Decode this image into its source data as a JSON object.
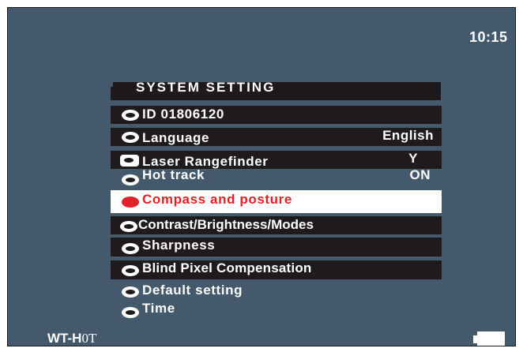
{
  "status": {
    "clock": "10:15",
    "model_prefix": "WT-H",
    "model_suffix": "0T"
  },
  "menu": {
    "title": "SYSTEM SETTING",
    "items": [
      {
        "label": "ID 01806120",
        "value": ""
      },
      {
        "label": "Language",
        "value": "English"
      },
      {
        "label": "Laser Rangefinder",
        "value": "Y"
      },
      {
        "label": "Hot track",
        "value": "ON"
      },
      {
        "label": "Compass and posture",
        "value": "",
        "selected": true
      },
      {
        "label": "Contrast/Brightness/Modes",
        "value": ""
      },
      {
        "label": "Sharpness",
        "value": ""
      },
      {
        "label": "Blind Pixel Compensation",
        "value": ""
      },
      {
        "label": "Default setting",
        "value": ""
      },
      {
        "label": "Time",
        "value": ""
      }
    ]
  },
  "colors": {
    "screen_bg": "#44596b",
    "row_dark": "#1f1b1c",
    "selected_text": "#e02226",
    "selected_bg": "#ffffff"
  }
}
